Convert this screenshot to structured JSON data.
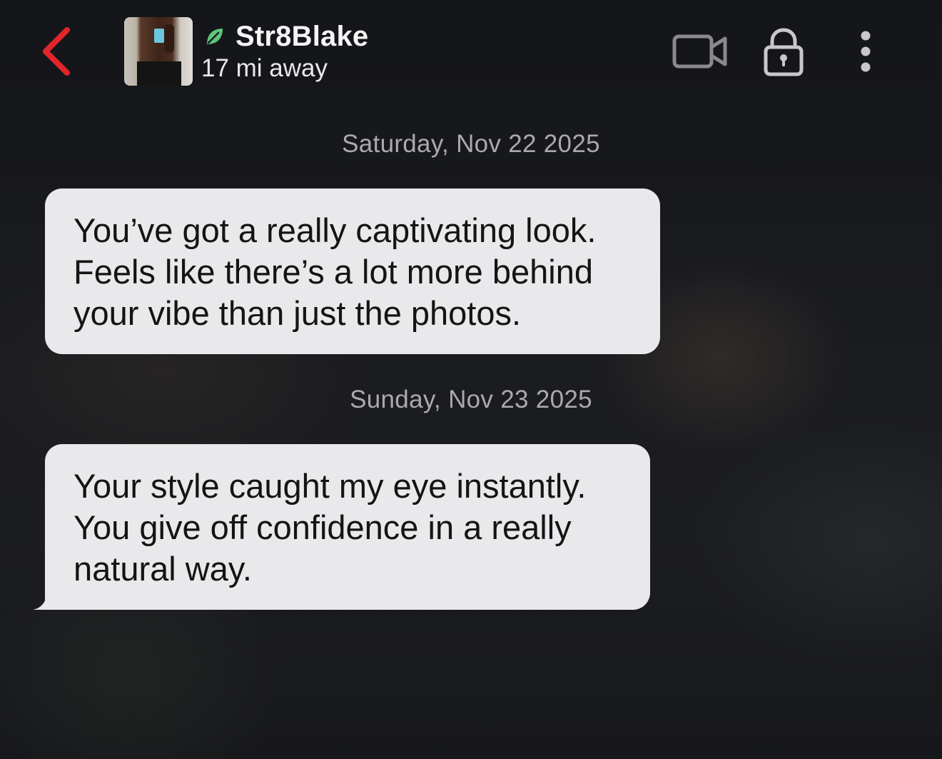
{
  "header": {
    "back_icon": "chevron-left-icon",
    "profile_name": "Str8Blake",
    "status_icon": "leaf-icon",
    "distance": "17 mi away",
    "actions": [
      "video-call-icon",
      "unlock-icon",
      "more-vertical-icon"
    ]
  },
  "colors": {
    "accent_red": "#e0262a",
    "online_green": "#5cc67a",
    "bubble_bg": "#e9e9ec",
    "date_text": "#a9a9ae"
  },
  "messages": [
    {
      "date": "Saturday, Nov 22 2025",
      "lines": [
        "You’ve got a really captivating look.",
        "Feels like there’s a lot more behind",
        "your vibe than just the photos."
      ]
    },
    {
      "date": "Sunday, Nov 23 2025",
      "lines": [
        "Your style caught my eye instantly.",
        "You give off confidence in a really",
        "natural way."
      ]
    }
  ]
}
